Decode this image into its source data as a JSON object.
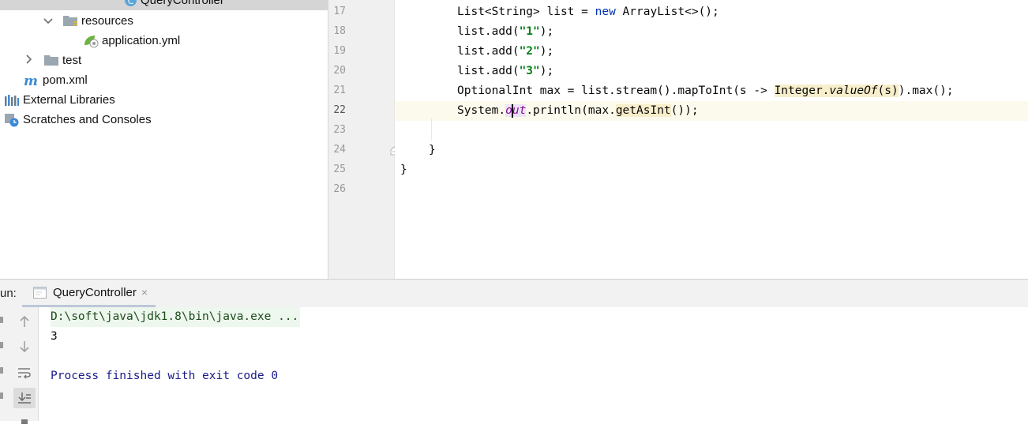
{
  "project_tree": {
    "items": [
      {
        "label": "QueryController",
        "icon": "class-icon"
      },
      {
        "label": "resources",
        "icon": "resources-folder-icon"
      },
      {
        "label": "application.yml",
        "icon": "spring-yml-icon"
      },
      {
        "label": "test",
        "icon": "folder-icon"
      },
      {
        "label": "pom.xml",
        "icon": "maven-icon"
      },
      {
        "label": "External Libraries",
        "icon": "libraries-icon"
      },
      {
        "label": "Scratches and Consoles",
        "icon": "scratches-icon"
      }
    ]
  },
  "editor": {
    "line_numbers": [
      "17",
      "18",
      "19",
      "20",
      "21",
      "22",
      "23",
      "24",
      "25",
      "26"
    ],
    "current_line": "22",
    "lines": [
      [
        "List<String> list = ",
        "new",
        " ArrayList<>();"
      ],
      [
        "list.add(",
        "\"1\"",
        ");"
      ],
      [
        "list.add(",
        "\"2\"",
        ");"
      ],
      [
        "list.add(",
        "\"3\"",
        ");"
      ],
      [
        "OptionalInt max = list.stream().mapToInt(s -> ",
        "Integer.",
        "valueOf",
        "(s)",
        ").max();"
      ],
      [
        "System.",
        "o",
        "ut",
        ".println(max.",
        "getAsInt",
        "());"
      ],
      [
        ""
      ],
      [
        "}"
      ],
      [
        "}"
      ],
      [
        ""
      ]
    ]
  },
  "run_panel": {
    "label": "un:",
    "tab_label": "QueryController",
    "tab_close": "×",
    "console": {
      "command": "D:\\soft\\java\\jdk1.8\\bin\\java.exe ...",
      "output": "3",
      "exit_message": "Process finished with exit code 0"
    }
  },
  "colors": {
    "keyword": "#0033b3",
    "string": "#067d17",
    "static_field": "#871094",
    "current_line_bg": "#fcfaed",
    "console_exit": "#1a1a8c"
  }
}
